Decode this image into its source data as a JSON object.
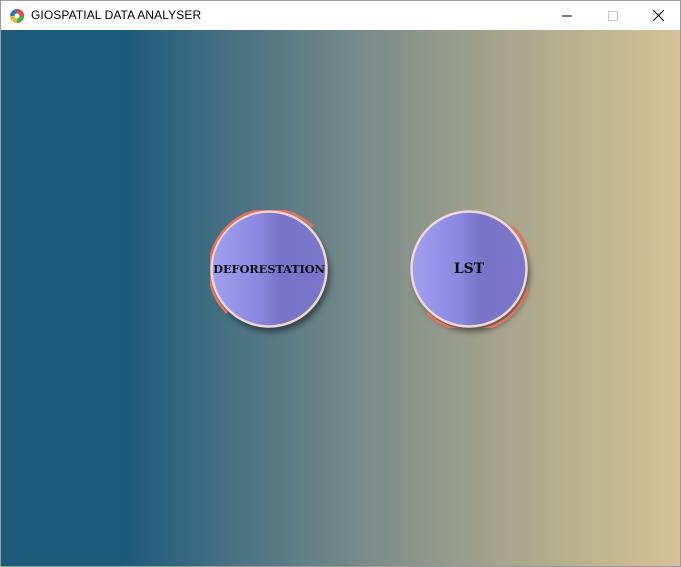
{
  "window": {
    "title": "GIOSPATIAL DATA ANALYSER",
    "app_icon": "globe-app-icon",
    "controls": {
      "minimize_icon": "minimize-icon",
      "maximize_icon": "maximize-icon",
      "close_icon": "close-icon"
    }
  },
  "main": {
    "buttons": [
      {
        "label": "DEFORESTATION"
      },
      {
        "label": "LST"
      }
    ]
  },
  "colors": {
    "gradient_left": "#1c5a7c",
    "gradient_right": "#d5c296",
    "button_fill": "#8a88e0",
    "button_ring": "#e8705a"
  }
}
